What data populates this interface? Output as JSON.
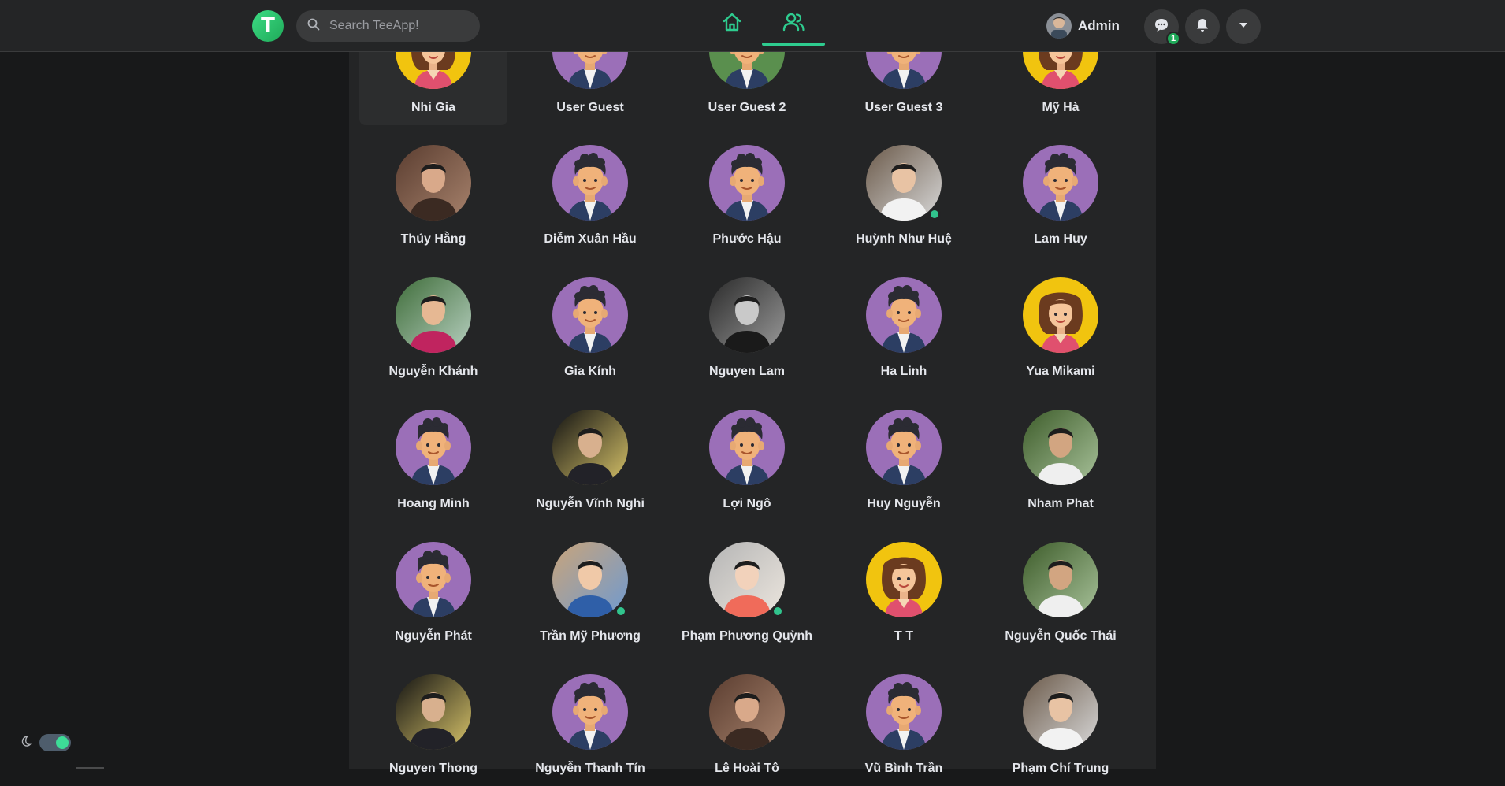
{
  "app": {
    "logo_letter": "T",
    "accent": "#2ecc8f"
  },
  "search": {
    "placeholder": "Search TeeApp!"
  },
  "nav": {
    "active": "friends"
  },
  "account": {
    "name": "Admin",
    "messages_badge": "1"
  },
  "people": [
    {
      "name": "Nhi Gia",
      "avatar": "yellow",
      "online": false,
      "clipped": true,
      "hover": true
    },
    {
      "name": "User Guest",
      "avatar": "purple",
      "online": false,
      "clipped": true
    },
    {
      "name": "User Guest 2",
      "avatar": "green",
      "online": false,
      "clipped": true
    },
    {
      "name": "User Guest 3",
      "avatar": "purple",
      "online": false,
      "clipped": true
    },
    {
      "name": "Mỹ Hà",
      "avatar": "yellow",
      "online": false,
      "clipped": true
    },
    {
      "name": "Thúy Hằng",
      "avatar": "photo-brown",
      "online": false
    },
    {
      "name": "Diễm Xuân Hầu",
      "avatar": "purple",
      "online": false
    },
    {
      "name": "Phước Hậu",
      "avatar": "purple",
      "online": false
    },
    {
      "name": "Huỳnh Như Huệ",
      "avatar": "photo-white",
      "online": true
    },
    {
      "name": "Lam Huy",
      "avatar": "purple",
      "online": false
    },
    {
      "name": "Nguyễn Khánh",
      "avatar": "photo-red",
      "online": false
    },
    {
      "name": "Gia Kính",
      "avatar": "purple",
      "online": false
    },
    {
      "name": "Nguyen Lam",
      "avatar": "photo-gray",
      "online": false
    },
    {
      "name": "Ha Linh",
      "avatar": "purple",
      "online": false
    },
    {
      "name": "Yua Mikami",
      "avatar": "yellow",
      "online": false
    },
    {
      "name": "Hoang Minh",
      "avatar": "purple",
      "online": false
    },
    {
      "name": "Nguyễn Vĩnh Nghi",
      "avatar": "photo-dark",
      "online": false
    },
    {
      "name": "Lợi Ngô",
      "avatar": "purple",
      "online": false
    },
    {
      "name": "Huy Nguyễn",
      "avatar": "purple",
      "online": false
    },
    {
      "name": "Nham Phat",
      "avatar": "photo-green",
      "online": false
    },
    {
      "name": "Nguyễn Phát",
      "avatar": "purple",
      "online": false
    },
    {
      "name": "Trần Mỹ Phương",
      "avatar": "photo-blue",
      "online": true
    },
    {
      "name": "Phạm Phương Quỳnh",
      "avatar": "photo-light",
      "online": true
    },
    {
      "name": "T T",
      "avatar": "yellow",
      "online": false
    },
    {
      "name": "Nguyễn Quốc Thái",
      "avatar": "photo-green",
      "online": false
    },
    {
      "name": "Nguyen Thong",
      "avatar": "photo-dark",
      "online": false
    },
    {
      "name": "Nguyễn Thanh Tín",
      "avatar": "purple",
      "online": false
    },
    {
      "name": "Lê Hoài Tô",
      "avatar": "photo-brown",
      "online": false
    },
    {
      "name": "Vũ Bình Trần",
      "avatar": "purple",
      "online": false
    },
    {
      "name": "Phạm Chí Trung",
      "avatar": "photo-white",
      "online": false
    }
  ]
}
